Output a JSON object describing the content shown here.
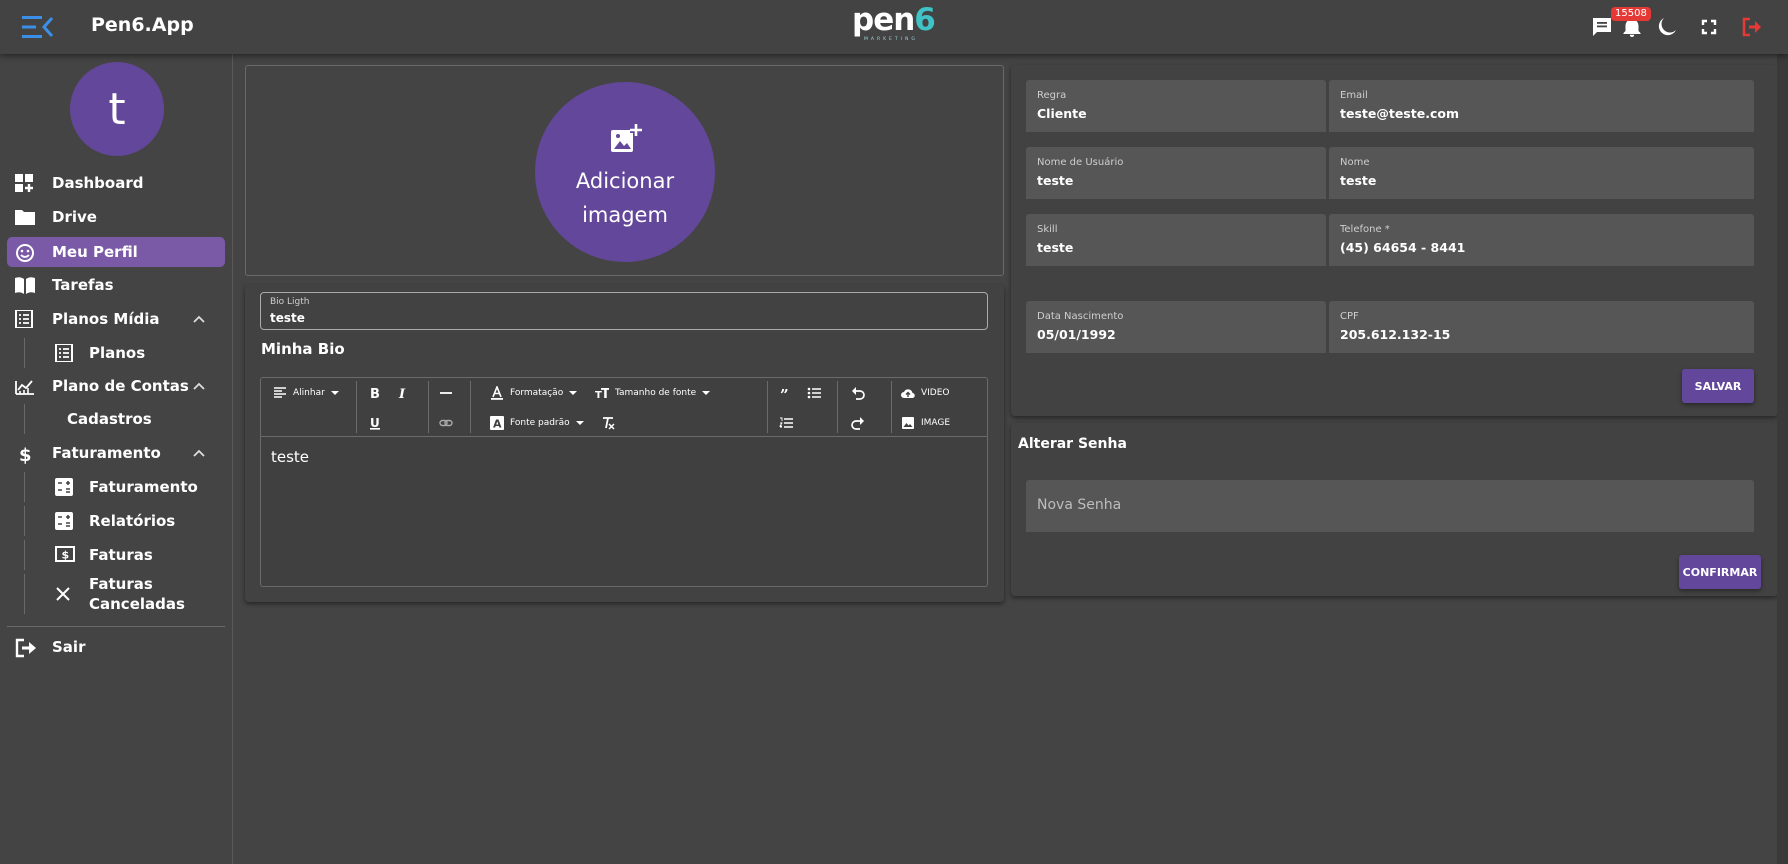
{
  "header": {
    "app_title": "Pen6.App",
    "logo_main": "pen",
    "logo_accent": "6",
    "logo_sub": "MARKETING",
    "notification_count": "15508",
    "icons": [
      "menu-toggle-icon",
      "chat-icon",
      "bell-icon",
      "theme-moon-icon",
      "fullscreen-icon",
      "logout-icon"
    ],
    "logout_color": "#e53935"
  },
  "sidebar": {
    "avatar_letter": "t",
    "items": [
      {
        "label": "Dashboard",
        "icon": "dashboard-icon"
      },
      {
        "label": "Drive",
        "icon": "folder-icon"
      },
      {
        "label": "Meu Perfil",
        "icon": "smiley-icon",
        "active": true
      },
      {
        "label": "Tarefas",
        "icon": "book-icon"
      },
      {
        "label": "Planos Mídia",
        "icon": "list-icon",
        "expanded": true
      },
      {
        "label": "Planos",
        "icon": "list-box-icon"
      },
      {
        "label": "Plano de Contas",
        "icon": "chart-line-icon",
        "expanded": true
      },
      {
        "label": "Cadastros"
      },
      {
        "label": "Faturamento",
        "icon": "dollar-icon",
        "expanded": true
      },
      {
        "label": "Faturamento",
        "icon": "calculator-icon"
      },
      {
        "label": "Relatórios",
        "icon": "calculator-icon"
      },
      {
        "label": "Faturas",
        "icon": "money-icon"
      },
      {
        "label": "Faturas",
        "label2": "Canceladas",
        "icon": "close-icon"
      },
      {
        "label": "Sair",
        "icon": "exit-icon"
      }
    ]
  },
  "upload": {
    "line1": "Adicionar",
    "line2": "imagem"
  },
  "bio": {
    "field_label": "Bio Ligth",
    "field_value": "teste",
    "title": "Minha Bio",
    "content": "teste",
    "toolbar": {
      "align": "Alinhar",
      "format": "Formatação",
      "font_size": "Tamanho de fonte",
      "font_default": "Fonte padrão",
      "video": "VIDEO",
      "image": "IMAGE"
    }
  },
  "profile": {
    "fields": {
      "role": {
        "label": "Regra",
        "value": "Cliente"
      },
      "email": {
        "label": "Email",
        "value": "teste@teste.com"
      },
      "username": {
        "label": "Nome de Usuário",
        "value": "teste"
      },
      "name": {
        "label": "Nome",
        "value": "teste"
      },
      "skill": {
        "label": "Skill",
        "value": "teste"
      },
      "phone": {
        "label": "Telefone *",
        "value": "(45) 64654 - 8441"
      },
      "birth": {
        "label": "Data Nascimento",
        "value": "05/01/1992"
      },
      "cpf": {
        "label": "CPF",
        "value": "205.612.132-15"
      }
    },
    "save_label": "SALVAR"
  },
  "password": {
    "title": "Alterar Senha",
    "placeholder": "Nova Senha",
    "confirm_label": "CONFIRMAR"
  },
  "colors": {
    "background": "#444444",
    "accent": "#63479a",
    "active_nav": "#7a5aa6",
    "field_bg": "#565656",
    "logo_accent": "#3fc3c6"
  }
}
